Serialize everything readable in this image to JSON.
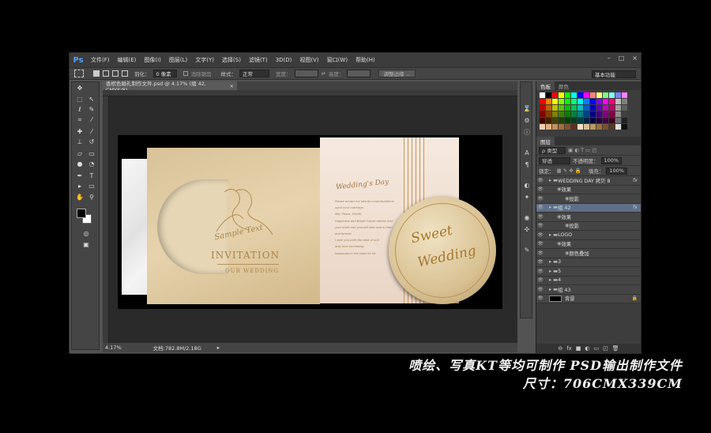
{
  "app": {
    "logo": "Ps"
  },
  "menu": [
    "文件(F)",
    "编辑(E)",
    "图像(I)",
    "图层(L)",
    "文字(Y)",
    "选择(S)",
    "滤镜(T)",
    "3D(D)",
    "视图(V)",
    "窗口(W)",
    "帮助(H)"
  ],
  "window_controls": [
    "–",
    "□",
    "×"
  ],
  "options": {
    "feather_label": "羽化：",
    "feather_value": "0 像素",
    "antialias_label": "消除锯齿",
    "style_label": "样式：",
    "style_value": "正常",
    "width_label": "宽度：",
    "height_label": "高度：",
    "refine_button": "调整边缘 ...",
    "workspace": "基本功能"
  },
  "document_tab": {
    "title": "香槟色婚礼制作文件.psd @ 4.17% (组 42, CMYK/8)",
    "close": "×"
  },
  "status": {
    "zoom": "4.17%",
    "doc_info": "文档:782.8M/2.18G",
    "arrow": "▸"
  },
  "card": {
    "sample_text": "Sample Text",
    "invitation": "INVITATION",
    "our_wedding": "OUR WEDDING",
    "wedding_day": "Wedding's Day",
    "body_lines": [
      "Please accept my beauty congratulations",
      "upon your marriage.",
      "May Peace, Health,",
      "Happiness and Bright Future attend both",
      "your bride and yourself with now & then",
      "and forever.",
      "I wish you both the best of luck",
      "and, love-increasing",
      "happiness in the years to be."
    ],
    "sweet": "Sweet",
    "wedding": "Wedding"
  },
  "panels": {
    "swatches_tabs": [
      "色板",
      "颜色"
    ],
    "layers_tabs": [
      "图层"
    ],
    "filter_label": "ρ 类型",
    "blend_mode": "穿透",
    "opacity_label": "不透明度：",
    "opacity_value": "100%",
    "lock_label": "锁定：",
    "fill_label": "填充：",
    "fill_value": "100%",
    "layers": [
      {
        "name": "WEDDING DAY 拷贝 8",
        "kind": "group",
        "indent": 0,
        "fx": "fx",
        "selected": false
      },
      {
        "name": "效果",
        "kind": "effect",
        "indent": 1,
        "fx": "",
        "selected": false
      },
      {
        "name": "投影",
        "kind": "effect",
        "indent": 2,
        "fx": "",
        "selected": false
      },
      {
        "name": "组 42",
        "kind": "group",
        "indent": 0,
        "fx": "fx",
        "selected": true
      },
      {
        "name": "效果",
        "kind": "effect",
        "indent": 1,
        "fx": "",
        "selected": false
      },
      {
        "name": "投影",
        "kind": "effect",
        "indent": 2,
        "fx": "",
        "selected": false
      },
      {
        "name": "LOGO",
        "kind": "group",
        "indent": 0,
        "fx": "",
        "selected": false
      },
      {
        "name": "效果",
        "kind": "effect",
        "indent": 1,
        "fx": "",
        "selected": false
      },
      {
        "name": "颜色叠加",
        "kind": "effect",
        "indent": 2,
        "fx": "",
        "selected": false
      },
      {
        "name": "3",
        "kind": "group",
        "indent": 0,
        "fx": "",
        "selected": false
      },
      {
        "name": "5",
        "kind": "group",
        "indent": 0,
        "fx": "",
        "selected": false
      },
      {
        "name": "4",
        "kind": "group",
        "indent": 0,
        "fx": "",
        "selected": false
      },
      {
        "name": "组 43",
        "kind": "group",
        "indent": 0,
        "fx": "",
        "selected": false
      },
      {
        "name": "背景",
        "kind": "background",
        "indent": 0,
        "fx": "",
        "selected": false
      }
    ],
    "bottom_icons": [
      "⊖",
      "fx",
      "■",
      "◐",
      "▭",
      "◰",
      "🗑"
    ]
  },
  "footer": {
    "line1": "喷绘、写真KT等均可制作  PSD输出制作文件",
    "line2": "尺寸：706CMX339CM"
  },
  "colors": {
    "gold": "#b8925a",
    "card_bg": "#e3cfa6",
    "pink_panel": "#f0dfd3",
    "selected_layer": "#5f6f88"
  }
}
